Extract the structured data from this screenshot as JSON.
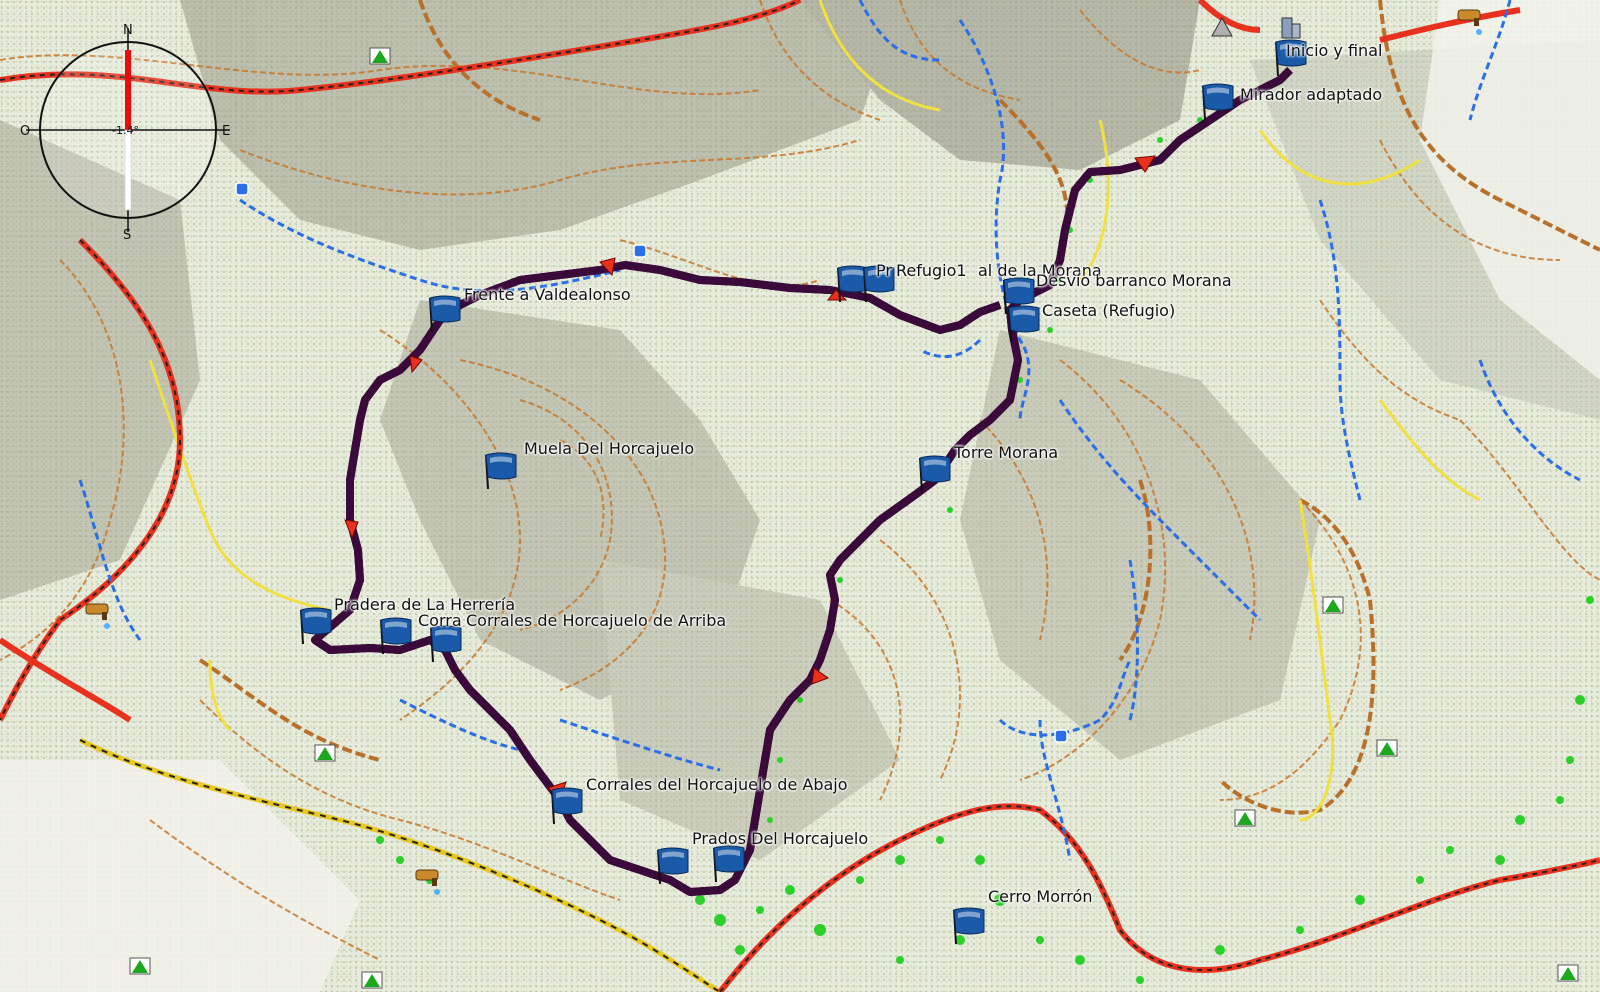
{
  "compass": {
    "north": "N",
    "south": "S",
    "east": "E",
    "west": "O",
    "heading": "-1.4°"
  },
  "waypoints": [
    {
      "id": "inicio",
      "name": "Inicio y final"
    },
    {
      "id": "mirador",
      "name": "Mirador adaptado"
    },
    {
      "id": "pr",
      "name": "Pr"
    },
    {
      "id": "refugio1",
      "name": "Refugio1"
    },
    {
      "id": "final-morana",
      "name": "al de la Morana"
    },
    {
      "id": "desvio",
      "name": "Desvío barranco Morana"
    },
    {
      "id": "caseta",
      "name": "Caseta (Refugio)"
    },
    {
      "id": "frente",
      "name": "Frente a Valdealonso"
    },
    {
      "id": "muela",
      "name": "Muela Del Horcajuelo"
    },
    {
      "id": "torre",
      "name": "Torre Morana"
    },
    {
      "id": "pradera",
      "name": "Pradera de La Herrería"
    },
    {
      "id": "corra",
      "name": "Corra"
    },
    {
      "id": "arriba",
      "name": "Corrales de Horcajuelo de Arriba"
    },
    {
      "id": "abajo",
      "name": "Corrales del Horcajuelo de Abajo"
    },
    {
      "id": "prados",
      "name": "Prados Del Horcajuelo"
    },
    {
      "id": "morron",
      "name": "Cerro Morrón"
    }
  ],
  "colors": {
    "track": "#c01fc8",
    "track_outline": "#3a0a3a",
    "river": "#2a6ee8",
    "contour": "#c8782a",
    "road_red": "#e8321e",
    "road_yellow": "#f0e040",
    "vegetation": "#2bd02b",
    "flag": "#1a5aa8"
  }
}
